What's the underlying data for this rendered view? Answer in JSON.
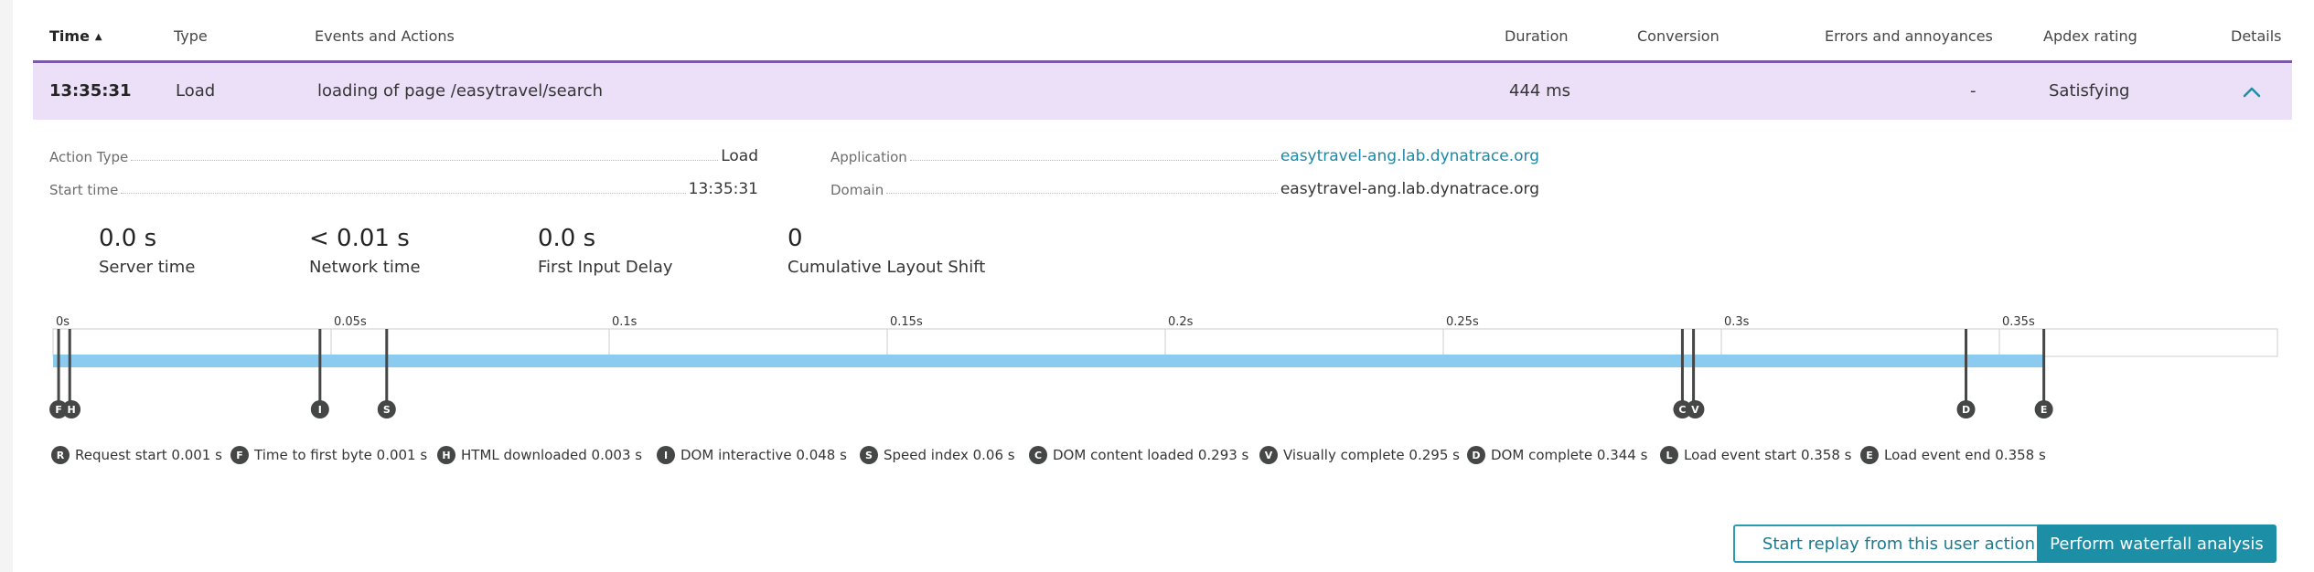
{
  "header": {
    "time": "Time",
    "type": "Type",
    "events": "Events and Actions",
    "duration": "Duration",
    "conversion": "Conversion",
    "errors": "Errors and annoyances",
    "apdex": "Apdex rating",
    "details": "Details"
  },
  "row": {
    "time": "13:35:31",
    "type": "Load",
    "event": "loading of page /easytravel/search",
    "duration": "444 ms",
    "errors": "-",
    "apdex": "Satisfying"
  },
  "details": {
    "action_type_label": "Action Type",
    "action_type_value": "Load",
    "start_time_label": "Start time",
    "start_time_value": "13:35:31",
    "application_label": "Application",
    "application_value": "easytravel-ang.lab.dynatrace.org",
    "domain_label": "Domain",
    "domain_value": "easytravel-ang.lab.dynatrace.org"
  },
  "metrics": [
    {
      "value": "0.0 s",
      "label": "Server time"
    },
    {
      "value": "< 0.01 s",
      "label": "Network time"
    },
    {
      "value": "0.0 s",
      "label": "First Input Delay"
    },
    {
      "value": "0",
      "label": "Cumulative Layout Shift"
    }
  ],
  "timeline": {
    "ticks": [
      "0s",
      "0.05s",
      "0.1s",
      "0.15s",
      "0.2s",
      "0.25s",
      "0.3s",
      "0.35s"
    ],
    "tick_values": [
      0,
      0.05,
      0.1,
      0.15,
      0.2,
      0.25,
      0.3,
      0.35
    ],
    "max": 0.4,
    "bar_end": 0.358,
    "bar_color": "#8ccbf0",
    "markers": [
      {
        "letter": "F",
        "t": 0.001
      },
      {
        "letter": "H",
        "t": 0.003
      },
      {
        "letter": "I",
        "t": 0.048
      },
      {
        "letter": "S",
        "t": 0.06
      },
      {
        "letter": "C",
        "t": 0.293
      },
      {
        "letter": "V",
        "t": 0.295
      },
      {
        "letter": "D",
        "t": 0.344
      },
      {
        "letter": "E",
        "t": 0.358
      }
    ]
  },
  "legend": [
    {
      "letter": "R",
      "text": "Request start 0.001 s"
    },
    {
      "letter": "F",
      "text": "Time to first byte 0.001 s"
    },
    {
      "letter": "H",
      "text": "HTML downloaded 0.003 s"
    },
    {
      "letter": "I",
      "text": "DOM interactive 0.048 s"
    },
    {
      "letter": "S",
      "text": "Speed index 0.06 s"
    },
    {
      "letter": "C",
      "text": "DOM content loaded 0.293 s"
    },
    {
      "letter": "V",
      "text": "Visually complete 0.295 s"
    },
    {
      "letter": "D",
      "text": "DOM complete 0.344 s"
    },
    {
      "letter": "L",
      "text": "Load event start 0.358 s"
    },
    {
      "letter": "E",
      "text": "Load event end 0.358 s"
    }
  ],
  "buttons": {
    "replay": "Start replay from this user action",
    "waterfall": "Perform waterfall analysis"
  },
  "icons": {
    "sort": "sort-ascending-icon",
    "expand": "chevron-up-icon"
  },
  "colors": {
    "accent": "#7a5aa6",
    "row_highlight": "#ecdff8",
    "link": "#1e88a8",
    "primary_button": "#1c8ea6"
  }
}
